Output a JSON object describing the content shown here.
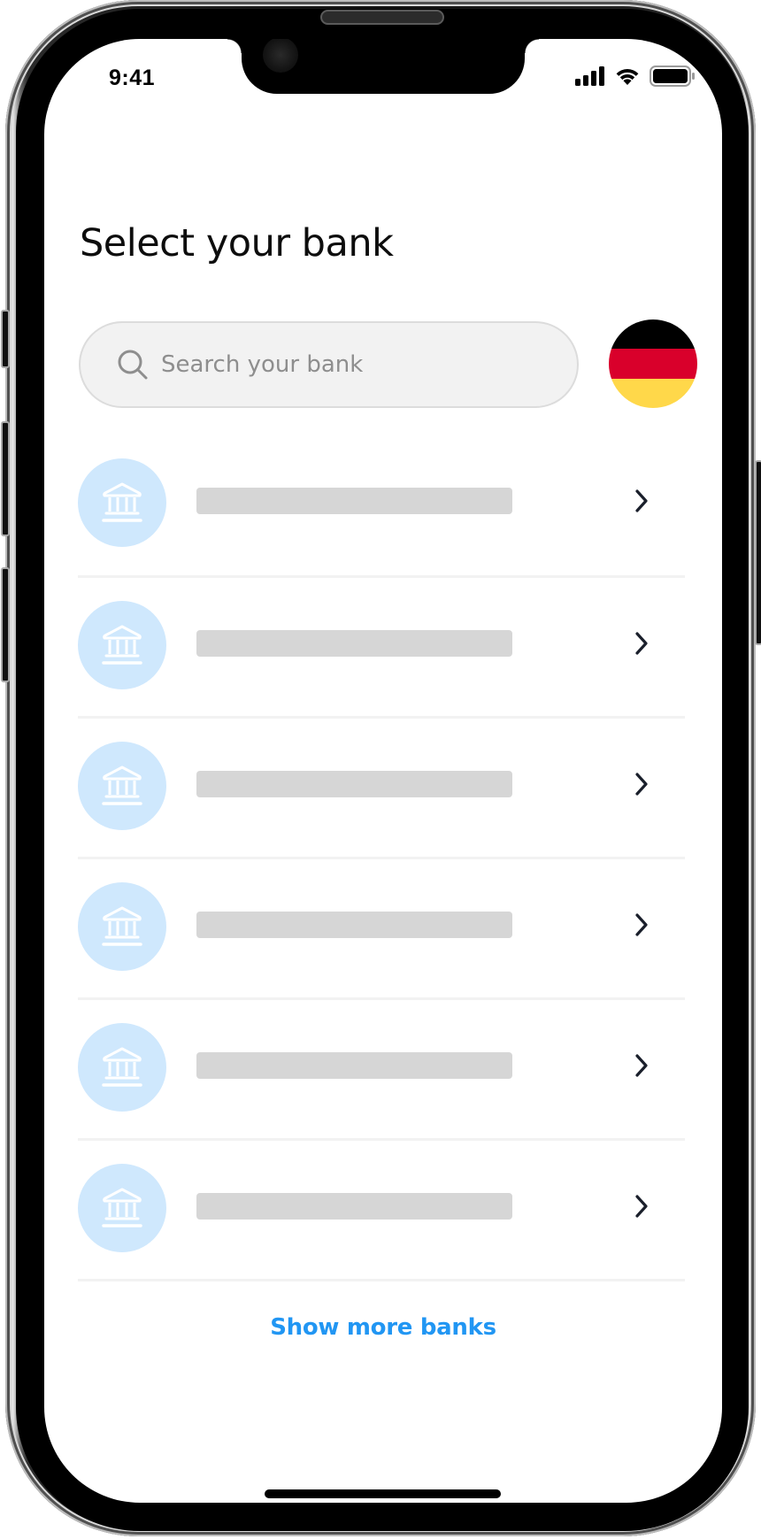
{
  "status_bar": {
    "time": "9:41",
    "icons": [
      "cellular-signal-icon",
      "wifi-icon",
      "battery-icon"
    ]
  },
  "header": {
    "title": "Select your bank"
  },
  "search": {
    "placeholder": "Search your bank",
    "value": "",
    "icon": "search-icon"
  },
  "country_selector": {
    "country": "Germany",
    "flag_colors": [
      "#000000",
      "#d9002b",
      "#ffd84a"
    ]
  },
  "bank_list": {
    "items": [
      {
        "icon": "bank-icon",
        "name": "",
        "loading": true
      },
      {
        "icon": "bank-icon",
        "name": "",
        "loading": true
      },
      {
        "icon": "bank-icon",
        "name": "",
        "loading": true
      },
      {
        "icon": "bank-icon",
        "name": "",
        "loading": true
      },
      {
        "icon": "bank-icon",
        "name": "",
        "loading": true
      },
      {
        "icon": "bank-icon",
        "name": "",
        "loading": true
      }
    ]
  },
  "footer": {
    "show_more_label": "Show more banks"
  },
  "colors": {
    "accent": "#2196f3",
    "avatar_bg": "#cfe8fd",
    "skeleton": "#d6d6d6",
    "divider": "#f2f2f2",
    "search_bg": "#f2f2f2",
    "chevron": "#1a1f2b"
  }
}
